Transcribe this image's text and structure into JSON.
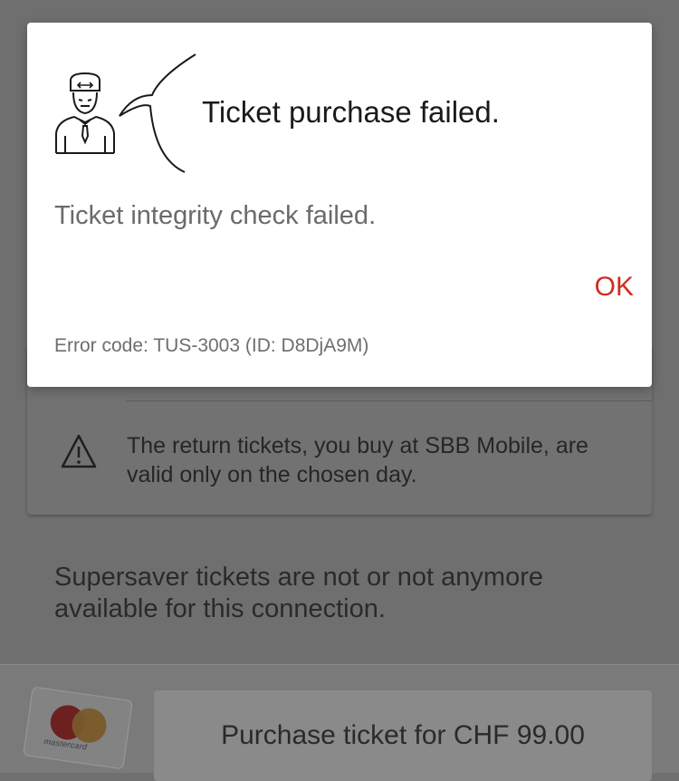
{
  "dialog": {
    "title": "Ticket purchase failed.",
    "message": "Ticket integrity check failed.",
    "ok_label": "OK",
    "error_code": "Error code: TUS-3003 (ID: D8DjA9M)",
    "icon": "conductor-icon",
    "accent_color": "#d42a20"
  },
  "background": {
    "notice": {
      "icon": "warning-icon",
      "text": "The return tickets, you buy at SBB Mobile, are valid only on the chosen day."
    },
    "info_text": "Supersaver tickets are not or not anymore available for this connection.",
    "payment": {
      "card_brand": "mastercard",
      "purchase_label": "Purchase ticket for CHF 99.00"
    }
  }
}
